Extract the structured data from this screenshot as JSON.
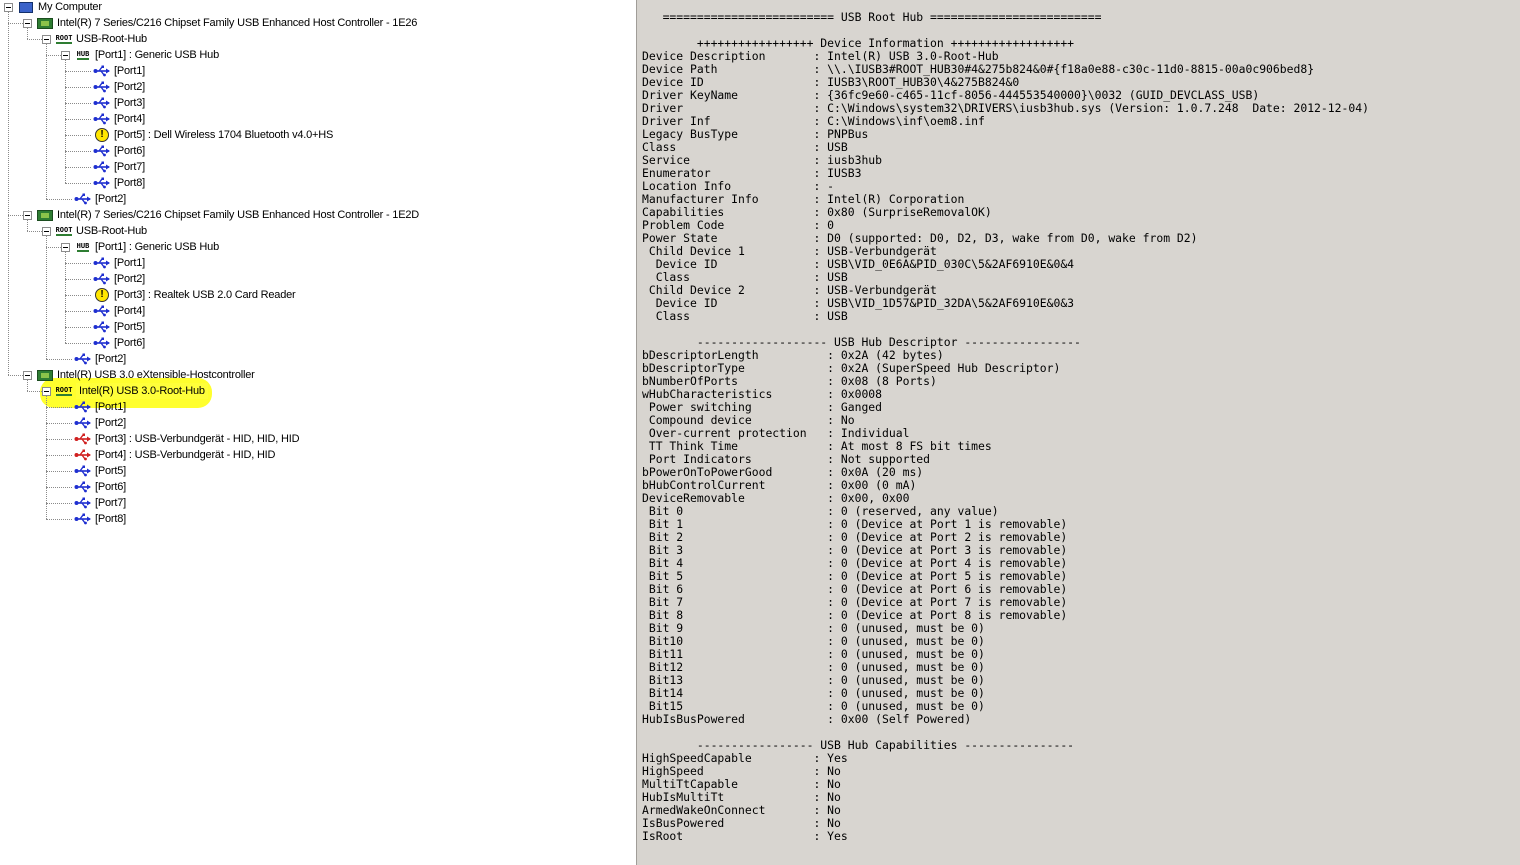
{
  "tree": {
    "nodes": [
      {
        "label": "My Computer",
        "icon": "computer-icon",
        "indent": 0
      },
      {
        "label": "Intel(R) 7 Series/C216 Chipset Family USB Enhanced Host Controller - 1E26",
        "icon": "controller-icon",
        "indent": 1
      },
      {
        "label": "USB-Root-Hub",
        "icon": "root-hub-icon",
        "indent": 2
      },
      {
        "label": "[Port1] : Generic USB Hub",
        "icon": "hub-icon",
        "indent": 3
      },
      {
        "label": "[Port1]",
        "icon": "usb-port-icon",
        "indent": 4
      },
      {
        "label": "[Port2]",
        "icon": "usb-port-icon",
        "indent": 4
      },
      {
        "label": "[Port3]",
        "icon": "usb-port-icon",
        "indent": 4
      },
      {
        "label": "[Port4]",
        "icon": "usb-port-icon",
        "indent": 4
      },
      {
        "label": "[Port5] : Dell Wireless 1704 Bluetooth v4.0+HS",
        "icon": "warning-icon",
        "indent": 4
      },
      {
        "label": "[Port6]",
        "icon": "usb-port-icon",
        "indent": 4
      },
      {
        "label": "[Port7]",
        "icon": "usb-port-icon",
        "indent": 4
      },
      {
        "label": "[Port8]",
        "icon": "usb-port-icon",
        "indent": 4
      },
      {
        "label": "[Port2]",
        "icon": "usb-port-icon",
        "indent": 3
      },
      {
        "label": "Intel(R) 7 Series/C216 Chipset Family USB Enhanced Host Controller - 1E2D",
        "icon": "controller-icon",
        "indent": 1
      },
      {
        "label": "USB-Root-Hub",
        "icon": "root-hub-icon",
        "indent": 2
      },
      {
        "label": "[Port1] : Generic USB Hub",
        "icon": "hub-icon",
        "indent": 3
      },
      {
        "label": "[Port1]",
        "icon": "usb-port-icon",
        "indent": 4
      },
      {
        "label": "[Port2]",
        "icon": "usb-port-icon",
        "indent": 4
      },
      {
        "label": "[Port3] : Realtek USB 2.0 Card Reader",
        "icon": "warning-icon",
        "indent": 4
      },
      {
        "label": "[Port4]",
        "icon": "usb-port-icon",
        "indent": 4
      },
      {
        "label": "[Port5]",
        "icon": "usb-port-icon",
        "indent": 4
      },
      {
        "label": "[Port6]",
        "icon": "usb-port-icon",
        "indent": 4
      },
      {
        "label": "[Port2]",
        "icon": "usb-port-icon",
        "indent": 3
      },
      {
        "label": "Intel(R) USB 3.0 eXtensible-Hostcontroller",
        "icon": "controller-icon",
        "indent": 1
      },
      {
        "label": "Intel(R) USB 3.0-Root-Hub",
        "icon": "root-hub-icon",
        "indent": 2,
        "selected": true
      },
      {
        "label": "[Port1]",
        "icon": "usb-port-icon",
        "indent": 3
      },
      {
        "label": "[Port2]",
        "icon": "usb-port-icon",
        "indent": 3
      },
      {
        "label": "[Port3] : USB-Verbundgerät - HID, HID, HID",
        "icon": "usb-device-icon",
        "indent": 3
      },
      {
        "label": "[Port4] : USB-Verbundgerät - HID, HID",
        "icon": "usb-device-icon",
        "indent": 3
      },
      {
        "label": "[Port5]",
        "icon": "usb-port-icon",
        "indent": 3
      },
      {
        "label": "[Port6]",
        "icon": "usb-port-icon",
        "indent": 3
      },
      {
        "label": "[Port7]",
        "icon": "usb-port-icon",
        "indent": 3
      },
      {
        "label": "[Port8]",
        "icon": "usb-port-icon",
        "indent": 3
      }
    ],
    "icon_text": {
      "root": "ROOT",
      "hub": "HUB",
      "warn": "!"
    }
  },
  "colors": {
    "highlight": "#ffff2e",
    "usb_blue": "#1f2fd0",
    "usb_red": "#d02020",
    "chip_green": "#2e7d32",
    "details_bg": "#d8d5d0"
  },
  "details": {
    "lines": [
      "   ========================= USB Root Hub =========================",
      "",
      "        +++++++++++++++++ Device Information ++++++++++++++++++",
      "Device Description       : Intel(R) USB 3.0-Root-Hub",
      "Device Path              : \\\\.\\IUSB3#ROOT_HUB30#4&275b824&0#{f18a0e88-c30c-11d0-8815-00a0c906bed8}",
      "Device ID                : IUSB3\\ROOT_HUB30\\4&275B824&0",
      "Driver KeyName           : {36fc9e60-c465-11cf-8056-444553540000}\\0032 (GUID_DEVCLASS_USB)",
      "Driver                   : C:\\Windows\\system32\\DRIVERS\\iusb3hub.sys (Version: 1.0.7.248  Date: 2012-12-04)",
      "Driver Inf               : C:\\Windows\\inf\\oem8.inf",
      "Legacy BusType           : PNPBus",
      "Class                    : USB",
      "Service                  : iusb3hub",
      "Enumerator               : IUSB3",
      "Location Info            : -",
      "Manufacturer Info        : Intel(R) Corporation",
      "Capabilities             : 0x80 (SurpriseRemovalOK)",
      "Problem Code             : 0",
      "Power State              : D0 (supported: D0, D2, D3, wake from D0, wake from D2)",
      " Child Device 1          : USB-Verbundgerät",
      "  Device ID              : USB\\VID_0E6A&PID_030C\\5&2AF6910E&0&4",
      "  Class                  : USB",
      " Child Device 2          : USB-Verbundgerät",
      "  Device ID              : USB\\VID_1D57&PID_32DA\\5&2AF6910E&0&3",
      "  Class                  : USB",
      "",
      "        ------------------- USB Hub Descriptor -----------------",
      "bDescriptorLength          : 0x2A (42 bytes)",
      "bDescriptorType            : 0x2A (SuperSpeed Hub Descriptor)",
      "bNumberOfPorts             : 0x08 (8 Ports)",
      "wHubCharacteristics        : 0x0008",
      " Power switching           : Ganged",
      " Compound device           : No",
      " Over-current protection   : Individual",
      " TT Think Time             : At most 8 FS bit times",
      " Port Indicators           : Not supported",
      "bPowerOnToPowerGood        : 0x0A (20 ms)",
      "bHubControlCurrent         : 0x00 (0 mA)",
      "DeviceRemovable            : 0x00, 0x00",
      " Bit 0                     : 0 (reserved, any value)",
      " Bit 1                     : 0 (Device at Port 1 is removable)",
      " Bit 2                     : 0 (Device at Port 2 is removable)",
      " Bit 3                     : 0 (Device at Port 3 is removable)",
      " Bit 4                     : 0 (Device at Port 4 is removable)",
      " Bit 5                     : 0 (Device at Port 5 is removable)",
      " Bit 6                     : 0 (Device at Port 6 is removable)",
      " Bit 7                     : 0 (Device at Port 7 is removable)",
      " Bit 8                     : 0 (Device at Port 8 is removable)",
      " Bit 9                     : 0 (unused, must be 0)",
      " Bit10                     : 0 (unused, must be 0)",
      " Bit11                     : 0 (unused, must be 0)",
      " Bit12                     : 0 (unused, must be 0)",
      " Bit13                     : 0 (unused, must be 0)",
      " Bit14                     : 0 (unused, must be 0)",
      " Bit15                     : 0 (unused, must be 0)",
      "HubIsBusPowered            : 0x00 (Self Powered)",
      "",
      "        ----------------- USB Hub Capabilities ----------------",
      "HighSpeedCapable         : Yes",
      "HighSpeed                : No",
      "MultiTtCapable           : No",
      "HubIsMultiTt             : No",
      "ArmedWakeOnConnect       : No",
      "IsBusPowered             : No",
      "IsRoot                   : Yes"
    ]
  }
}
